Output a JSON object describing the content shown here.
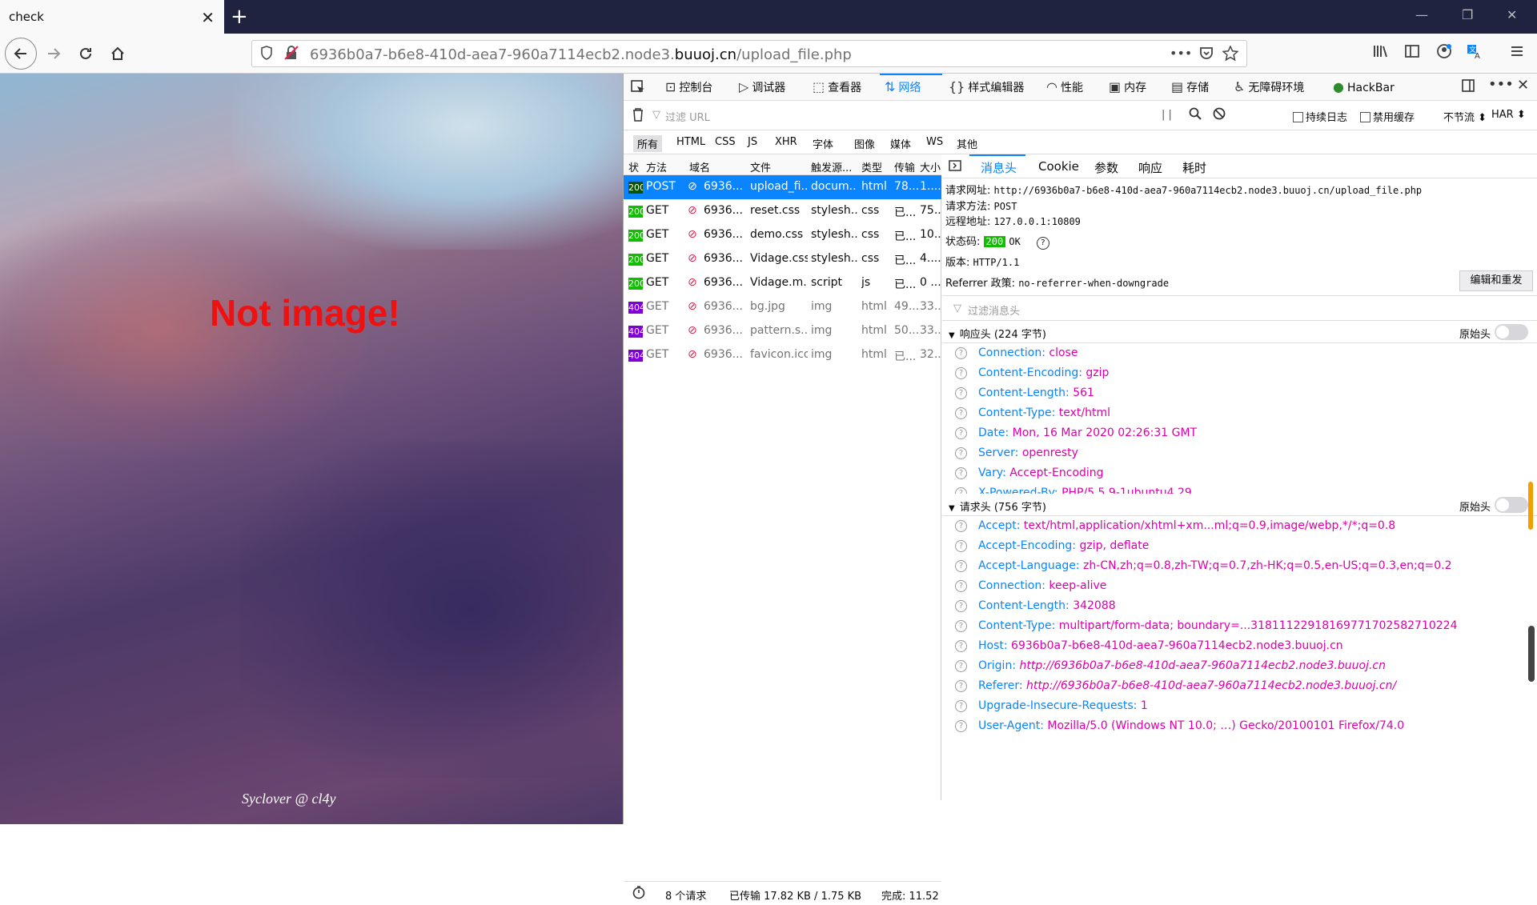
{
  "browser": {
    "tab_title": "check",
    "tab_close": "✕",
    "new_tab": "+",
    "win_min": "—",
    "win_restore": "❐",
    "win_close": "✕",
    "url_prefix": "6936b0a7-b6e8-410d-aea7-960a7114ecb2.node3.",
    "url_domain": "buuoj.cn",
    "url_path": "/upload_file.php",
    "url_more": "•••"
  },
  "page": {
    "message": "Not image!",
    "credit": "Syclover @ cl4y"
  },
  "devtools": {
    "tools": [
      "控制台",
      "调试器",
      "查看器",
      "网络",
      "样式编辑器",
      "性能",
      "内存",
      "存储",
      "无障碍环境",
      "HackBar"
    ],
    "tool_icons": [
      "console-icon",
      "debugger-icon",
      "inspector-icon",
      "network-icon",
      "style-editor-icon",
      "performance-icon",
      "memory-icon",
      "storage-icon",
      "accessibility-icon",
      "hackbar-icon"
    ],
    "active_tool": "网络",
    "filter_url_placeholder": "过滤 URL",
    "pause": "| |",
    "persist_logs": "持续日志",
    "disable_cache": "禁用缓存",
    "throttle": "不节流 ⬍",
    "har": "HAR ⬍",
    "types": [
      "所有",
      "HTML",
      "CSS",
      "JS",
      "XHR",
      "字体",
      "图像",
      "媒体",
      "WS",
      "其他"
    ],
    "list_headers": [
      "状",
      "方法",
      "域名",
      "文件",
      "触发源...",
      "类型",
      "传输",
      "大小"
    ],
    "requests": [
      {
        "status": "200",
        "method": "POST",
        "domain": "6936...",
        "file": "upload_fi...",
        "cause": "docum...",
        "type": "html",
        "transferred": "78...",
        "size": "1...."
      },
      {
        "status": "200",
        "method": "GET",
        "domain": "6936...",
        "file": "reset.css",
        "cause": "stylesh...",
        "type": "css",
        "transferred": "已...",
        "size": "75..."
      },
      {
        "status": "200",
        "method": "GET",
        "domain": "6936...",
        "file": "demo.css",
        "cause": "stylesh...",
        "type": "css",
        "transferred": "已...",
        "size": "10..."
      },
      {
        "status": "200",
        "method": "GET",
        "domain": "6936...",
        "file": "Vidage.css",
        "cause": "stylesh...",
        "type": "css",
        "transferred": "已...",
        "size": "4...."
      },
      {
        "status": "200",
        "method": "GET",
        "domain": "6936...",
        "file": "Vidage.m...",
        "cause": "script",
        "type": "js",
        "transferred": "已...",
        "size": "0 ..."
      },
      {
        "status": "404",
        "method": "GET",
        "domain": "6936...",
        "file": "bg.jpg",
        "cause": "img",
        "type": "html",
        "transferred": "49...",
        "size": "33..."
      },
      {
        "status": "404",
        "method": "GET",
        "domain": "6936...",
        "file": "pattern.s...",
        "cause": "img",
        "type": "html",
        "transferred": "50...",
        "size": "33..."
      },
      {
        "status": "404",
        "method": "GET",
        "domain": "6936...",
        "file": "favicon.ico",
        "cause": "img",
        "type": "html",
        "transferred": "已...",
        "size": "32..."
      }
    ],
    "footer": {
      "count": "8 个请求",
      "transferred": "已传输 17.82 KB / 1.75 KB",
      "finish": "完成: 11.52"
    },
    "detail_tabs": [
      "消息头",
      "Cookie",
      "参数",
      "响应",
      "耗时"
    ],
    "summary": {
      "url_label": "请求网址:",
      "url": "http://6936b0a7-b6e8-410d-aea7-960a7114ecb2.node3.buuoj.cn/upload_file.php",
      "method_label": "请求方法:",
      "method": "POST",
      "remote_label": "远程地址:",
      "remote": "127.0.0.1:10809",
      "status_label": "状态码:",
      "status_code": "200",
      "status_text": "OK",
      "version_label": "版本:",
      "version": "HTTP/1.1",
      "referrer_label": "Referrer 政策:",
      "referrer": "no-referrer-when-downgrade",
      "resend": "编辑和重发",
      "filter_headers": "过滤消息头"
    },
    "response_section": {
      "title": "响应头 (224 字节)",
      "raw": "原始头"
    },
    "response_headers": [
      {
        "name": "Connection: ",
        "value": "close"
      },
      {
        "name": "Content-Encoding: ",
        "value": "gzip"
      },
      {
        "name": "Content-Length: ",
        "value": "561"
      },
      {
        "name": "Content-Type: ",
        "value": "text/html"
      },
      {
        "name": "Date: ",
        "value": "Mon, 16 Mar 2020 02:26:31 GMT"
      },
      {
        "name": "Server: ",
        "value": "openresty"
      },
      {
        "name": "Vary: ",
        "value": "Accept-Encoding"
      },
      {
        "name": "X-Powered-By: ",
        "value": "PHP/5.5.9-1ubuntu4.29"
      }
    ],
    "request_section": {
      "title": "请求头 (756 字节)",
      "raw": "原始头"
    },
    "request_headers": [
      {
        "name": "Accept: ",
        "value": "text/html,application/xhtml+xm...ml;q=0.9,image/webp,*/*;q=0.8"
      },
      {
        "name": "Accept-Encoding: ",
        "value": "gzip, deflate"
      },
      {
        "name": "Accept-Language: ",
        "value": "zh-CN,zh;q=0.8,zh-TW;q=0.7,zh-HK;q=0.5,en-US;q=0.3,en;q=0.2"
      },
      {
        "name": "Connection: ",
        "value": "keep-alive"
      },
      {
        "name": "Content-Length: ",
        "value": "342088"
      },
      {
        "name": "Content-Type: ",
        "value": "multipart/form-data; boundary=...318111229181697717025827102​24"
      },
      {
        "name": "Host: ",
        "value": "6936b0a7-b6e8-410d-aea7-960a7114ecb2.node3.buuoj.cn"
      },
      {
        "name": "Origin: ",
        "value": "http://6936b0a7-b6e8-410d-aea7-960a7114ecb2.node3.buuoj.cn"
      },
      {
        "name": "Referer: ",
        "value": "http://6936b0a7-b6e8-410d-aea7-960a7114ecb2.node3.buuoj.cn/"
      },
      {
        "name": "Upgrade-Insecure-Requests: ",
        "value": "1"
      },
      {
        "name": "User-Agent: ",
        "value": "Mozilla/5.0 (Windows NT 10.0; …) Gecko/20100101 Firefox/74.0"
      }
    ]
  }
}
